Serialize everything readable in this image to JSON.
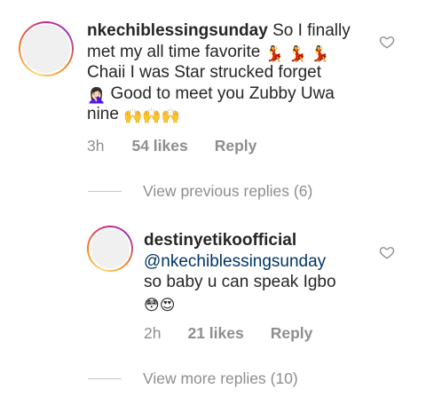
{
  "comments": [
    {
      "username": "nkechiblessingsunday",
      "text_line1": " So I finally",
      "text_line2": "met my all time favorite ",
      "text_line2_emoji": "💃 💃 💃",
      "text_line3": "Chaii I was Star strucked forget",
      "text_line4_emoji": "🤦🏻‍♀️",
      "text_line4": " Good to meet you Zubby Uwa",
      "text_line5": "nine ",
      "text_line5_emoji": "🙌🙌🙌",
      "time": "3h",
      "likes": "54 likes",
      "reply_label": "Reply",
      "like_icon": "heart-outline-icon"
    }
  ],
  "view_previous": "View previous replies (6)",
  "replies": [
    {
      "username": "destinyetikoofficial",
      "mention": "@nkechiblessingsunday",
      "text": "so baby u can speak Igbo",
      "emoji": "😳😍",
      "time": "2h",
      "likes": "21 likes",
      "reply_label": "Reply",
      "like_icon": "heart-outline-icon"
    }
  ],
  "view_more": "View more replies (10)",
  "colors": {
    "text": "#262626",
    "secondary": "#8e8e8e",
    "mention": "#003569"
  }
}
